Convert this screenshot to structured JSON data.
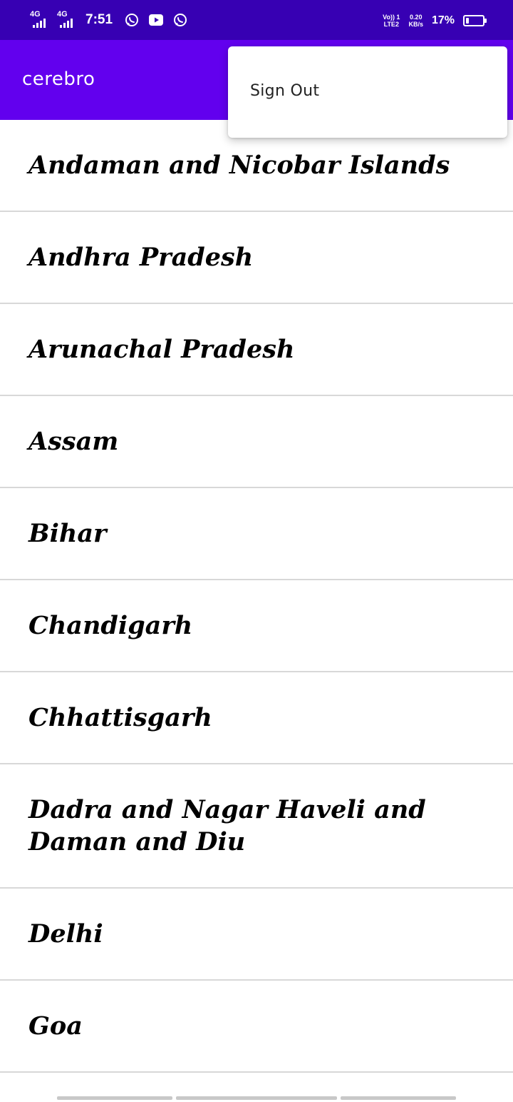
{
  "status_bar": {
    "network_1": "4G",
    "network_2": "4G",
    "time": "7:51",
    "notification_icons": [
      "whatsapp-icon",
      "youtube-icon",
      "whatsapp-icon"
    ],
    "volte_top": "Vo)) 1",
    "volte_bottom": "LTE2",
    "speed_value": "0.20",
    "speed_unit": "KB/s",
    "battery_percent": "17%",
    "battery_level": 0.17
  },
  "app_bar": {
    "title": "cerebro",
    "color": "#6200ee",
    "status_color": "#3700b3"
  },
  "overflow_menu": {
    "items": [
      {
        "label": "Sign Out"
      }
    ]
  },
  "states": [
    "Andaman and Nicobar Islands",
    "Andhra Pradesh",
    "Arunachal Pradesh",
    "Assam",
    "Bihar",
    "Chandigarh",
    "Chhattisgarh",
    "Dadra and Nagar Haveli and Daman and Diu",
    "Delhi",
    "Goa"
  ]
}
